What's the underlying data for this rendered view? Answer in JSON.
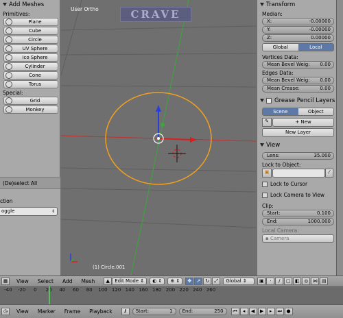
{
  "tool_shelf": {
    "title": "Add Meshes",
    "primitives_label": "Primitives:",
    "primitives": [
      "Plane",
      "Cube",
      "Circle",
      "UV Sphere",
      "Ico Sphere",
      "Cylinder",
      "Cone",
      "Torus"
    ],
    "special_label": "Special:",
    "special": [
      "Grid",
      "Monkey"
    ]
  },
  "operator": {
    "title": "(De)select All",
    "action_label": "ction",
    "action_value": "oggle"
  },
  "viewport": {
    "view_label": "User Ortho",
    "logo_text": "CRAVE",
    "object_label": "(1) Circle.001"
  },
  "transform": {
    "title": "Transform",
    "median_label": "Median:",
    "x_label": "X:",
    "x_value": "-0.00000",
    "y_label": "Y:",
    "y_value": "-0.00000",
    "z_label": "Z:",
    "z_value": "0.00000",
    "global_label": "Global",
    "local_label": "Local",
    "vertices_data_label": "Vertices Data:",
    "mean_bevel_vert_label": "Mean Bevel Weig:",
    "mean_bevel_vert_value": "0.00",
    "edges_data_label": "Edges Data:",
    "mean_bevel_edge_label": "Mean Bevel Weig:",
    "mean_bevel_edge_value": "0.00",
    "mean_crease_label": "Mean Crease:",
    "mean_crease_value": "0.00"
  },
  "grease_pencil": {
    "title": "Grease Pencil Layers",
    "scene_label": "Scene",
    "object_label": "Object",
    "new_label": "New",
    "new_layer_label": "New Layer"
  },
  "view_panel": {
    "title": "View",
    "lens_label": "Lens:",
    "lens_value": "35.000",
    "lock_to_object_label": "Lock to Object:",
    "lock_to_cursor_label": "Lock to Cursor",
    "lock_camera_label": "Lock Camera to View",
    "clip_label": "Clip:",
    "start_label": "Start:",
    "start_value": "0.100",
    "end_label": "End:",
    "end_value": "1000.000",
    "local_camera_label": "Local Camera:",
    "camera_value": "Camera"
  },
  "header": {
    "menus": [
      "View",
      "Select",
      "Add",
      "Mesh"
    ],
    "mode": "Edit Mode",
    "orientation": "Global"
  },
  "timeline": {
    "ticks": [
      "-40",
      "-20",
      "0",
      "20",
      "40",
      "60",
      "80",
      "100",
      "120",
      "140",
      "160",
      "180",
      "200",
      "220",
      "240",
      "260"
    ],
    "menus": [
      "View",
      "Marker",
      "Frame",
      "Playback"
    ],
    "start_label": "Start:",
    "start_value": "1",
    "end_label": "End:",
    "end_value": "250"
  },
  "colors": {
    "selection_circle": "#f0a020",
    "x_axis": "#d62020",
    "y_axis": "#3aa83a",
    "z_axis": "#2a3fd8",
    "active_toggle": "#5c79a8"
  }
}
